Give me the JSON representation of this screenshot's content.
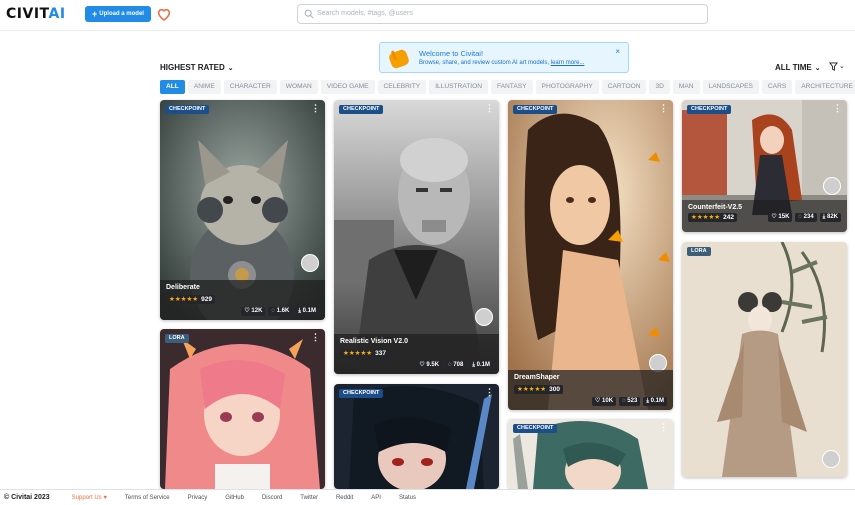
{
  "header": {
    "logo_main": "CIVIT",
    "logo_accent": "AI",
    "upload_label": "Upload a model",
    "search_placeholder": "Search models, #tags, @users"
  },
  "welcome": {
    "title": "Welcome to Civitai!",
    "subtitle": "Browse, share, and review custom AI art models,",
    "link": "learn more...",
    "close": "×"
  },
  "toolbar": {
    "sort_label": "HIGHEST RATED",
    "period_label": "ALL TIME"
  },
  "tags": [
    "ALL",
    "ANIME",
    "CHARACTER",
    "WOMAN",
    "VIDEO GAME",
    "CELEBRITY",
    "ILLUSTRATION",
    "FANTASY",
    "PHOTOGRAPHY",
    "CARTOON",
    "3D",
    "MAN",
    "LANDSCAPES",
    "CARS",
    "ARCHITECTURE"
  ],
  "cards": [
    {
      "type": "CHECKPOINT",
      "title": "Deliberate",
      "stars": "★★★★★",
      "rating": "929",
      "likes": "♡ 12K",
      "comments": "◌ 1.6K",
      "downloads": "⤓ 0.1M"
    },
    {
      "type": "CHECKPOINT",
      "title": "Realistic Vision V2.0",
      "stars": "★★★★★",
      "rating": "337",
      "likes": "♡ 9.5K",
      "comments": "◌ 708",
      "downloads": "⤓ 0.1M"
    },
    {
      "type": "CHECKPOINT",
      "title": "DreamShaper",
      "stars": "★★★★★",
      "rating": "300",
      "likes": "♡ 10K",
      "comments": "◌ 523",
      "downloads": "⤓ 0.1M"
    },
    {
      "type": "CHECKPOINT",
      "title": "Counterfeit-V2.5",
      "stars": "★★★★★",
      "rating": "242",
      "likes": "♡ 15K",
      "comments": "◌ 234",
      "downloads": "⤓ 82K"
    },
    {
      "type": "LORA"
    },
    {
      "type": "CHECKPOINT"
    },
    {
      "type": "CHECKPOINT"
    },
    {
      "type": "LORA"
    }
  ],
  "footer": {
    "copyright": "© Civitai 2023",
    "support": "Support Us ♥",
    "links": [
      "Terms of Service",
      "Privacy",
      "GitHub",
      "Discord",
      "Twitter",
      "Reddit",
      "API",
      "Status"
    ]
  },
  "colors": {
    "accent": "#228be6",
    "heart": "#f06f43",
    "star": "#fab005"
  }
}
